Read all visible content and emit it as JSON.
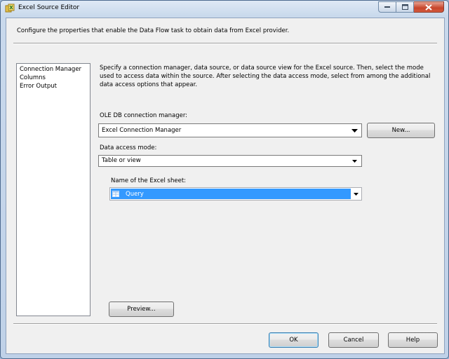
{
  "window": {
    "title": "Excel Source Editor"
  },
  "header": {
    "description": "Configure the properties that enable the Data Flow task to obtain data from Excel provider."
  },
  "nav": {
    "items": [
      {
        "label": "Connection Manager"
      },
      {
        "label": "Columns"
      },
      {
        "label": "Error Output"
      }
    ]
  },
  "main": {
    "description": "Specify a connection manager, data source, or data source view for the Excel source. Then, select the mode used to access data within the source. After selecting the data access mode, select from among the additional data access options that appear.",
    "connection_manager_label": "OLE DB connection manager:",
    "connection_manager_value": "Excel Connection Manager",
    "new_button": "New...",
    "access_mode_label": "Data access mode:",
    "access_mode_value": "Table or view",
    "sheet_label": "Name of the Excel sheet:",
    "sheet_value": "Query",
    "preview_button": "Preview..."
  },
  "footer": {
    "ok": "OK",
    "cancel": "Cancel",
    "help": "Help"
  },
  "colors": {
    "selection": "#3399ff",
    "window_frame": "#bfd1e8",
    "dialog_bg": "#f0f0f0"
  },
  "icons": [
    "excel-source-icon",
    "minimize-icon",
    "maximize-icon",
    "close-icon",
    "dropdown-arrow-icon",
    "table-icon"
  ]
}
